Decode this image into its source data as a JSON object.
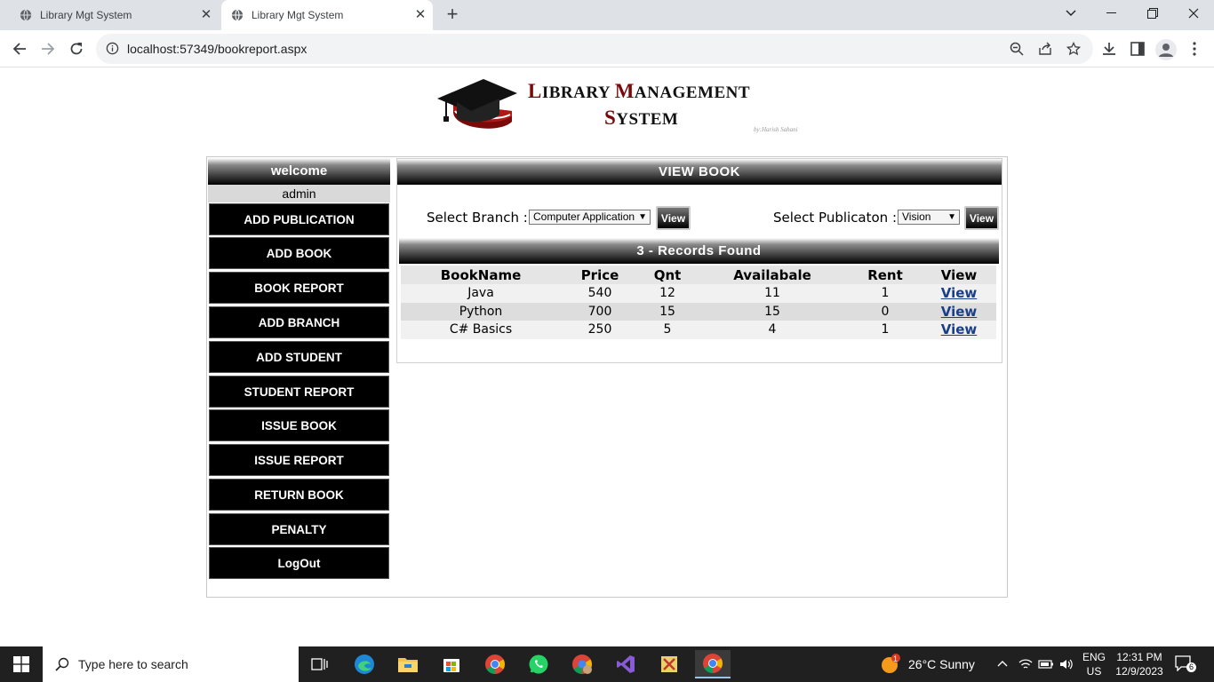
{
  "browser": {
    "tabs": [
      {
        "title": "Library Mgt System",
        "active": false
      },
      {
        "title": "Library Mgt System",
        "active": true
      }
    ],
    "url": "localhost:57349/bookreport.aspx"
  },
  "header": {
    "logo_line1_initial": "L",
    "logo_line1_rest": "IBRARY ",
    "logo_line1_initial2": "M",
    "logo_line1_rest2": "ANAGEMENT",
    "logo_line2_initial": "S",
    "logo_line2_rest": "YSTEM",
    "byline": "by:Harish Sahani"
  },
  "sidebar": {
    "welcome": "welcome",
    "username": "admin",
    "items": [
      {
        "label": "ADD PUBLICATION"
      },
      {
        "label": "ADD BOOK"
      },
      {
        "label": "BOOK REPORT"
      },
      {
        "label": "ADD BRANCH"
      },
      {
        "label": "ADD STUDENT"
      },
      {
        "label": "STUDENT REPORT"
      },
      {
        "label": "ISSUE BOOK"
      },
      {
        "label": "ISSUE REPORT"
      },
      {
        "label": "RETURN BOOK"
      },
      {
        "label": "PENALTY"
      },
      {
        "label": "LogOut"
      }
    ]
  },
  "main": {
    "title": "VIEW BOOK",
    "branch_label": "Select Branch :",
    "branch_value": "Computer Application",
    "branch_button": "View",
    "publication_label": "Select Publicaton :",
    "publication_value": "Vision",
    "publication_button": "View",
    "records_text": "3 - Records Found",
    "table": {
      "columns": [
        "BookName",
        "Price",
        "Qnt",
        "Availabale",
        "Rent",
        "View"
      ],
      "rows": [
        {
          "name": "Java",
          "price": "540",
          "qnt": "12",
          "available": "11",
          "rent": "1",
          "view": "View"
        },
        {
          "name": "Python",
          "price": "700",
          "qnt": "15",
          "available": "15",
          "rent": "0",
          "view": "View"
        },
        {
          "name": "C# Basics",
          "price": "250",
          "qnt": "5",
          "available": "4",
          "rent": "1",
          "view": "View"
        }
      ]
    }
  },
  "taskbar": {
    "search_placeholder": "Type here to search",
    "weather": "26°C  Sunny",
    "weather_badge": "1",
    "lang1": "ENG",
    "lang2": "US",
    "time": "12:31 PM",
    "date": "12/9/2023",
    "notifications": "6"
  }
}
